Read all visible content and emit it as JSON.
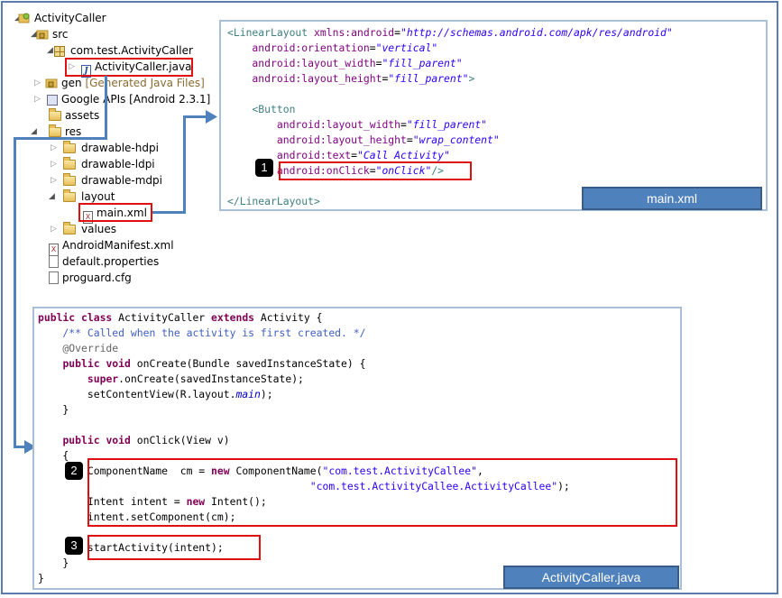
{
  "tree": {
    "items": [
      {
        "label": "ActivityCaller"
      },
      {
        "label": "src"
      },
      {
        "label": "com.test.ActivityCaller"
      },
      {
        "label": "ActivityCaller.java"
      },
      {
        "label": "gen",
        "suffix": "[Generated Java Files]"
      },
      {
        "label": "Google APIs [Android 2.3.1]"
      },
      {
        "label": "assets"
      },
      {
        "label": "res"
      },
      {
        "label": "drawable-hdpi"
      },
      {
        "label": "drawable-ldpi"
      },
      {
        "label": "drawable-mdpi"
      },
      {
        "label": "layout"
      },
      {
        "label": "main.xml"
      },
      {
        "label": "values"
      },
      {
        "label": "AndroidManifest.xml"
      },
      {
        "label": "default.properties"
      },
      {
        "label": "proguard.cfg"
      }
    ]
  },
  "xml_panel": {
    "label": "main.xml",
    "lines": [
      [
        {
          "t": "<LinearLayout ",
          "c": "tag"
        },
        {
          "t": "xmlns:android",
          "c": "attr"
        },
        {
          "t": "=",
          "c": "pl"
        },
        {
          "t": "\"http://schemas.android.com/apk/res/android\"",
          "c": "val"
        }
      ],
      [
        {
          "t": "    android:orientation",
          "c": "attr"
        },
        {
          "t": "=",
          "c": "pl"
        },
        {
          "t": "\"vertical\"",
          "c": "val"
        }
      ],
      [
        {
          "t": "    android:layout_width",
          "c": "attr"
        },
        {
          "t": "=",
          "c": "pl"
        },
        {
          "t": "\"fill_parent\"",
          "c": "val"
        }
      ],
      [
        {
          "t": "    android:layout_height",
          "c": "attr"
        },
        {
          "t": "=",
          "c": "pl"
        },
        {
          "t": "\"fill_parent\"",
          "c": "val"
        },
        {
          "t": ">",
          "c": "tag"
        }
      ],
      [],
      [
        {
          "t": "    <Button",
          "c": "tag"
        }
      ],
      [
        {
          "t": "        android:layout_width",
          "c": "attr"
        },
        {
          "t": "=",
          "c": "pl"
        },
        {
          "t": "\"fill_parent\"",
          "c": "val"
        }
      ],
      [
        {
          "t": "        android:layout_height",
          "c": "attr"
        },
        {
          "t": "=",
          "c": "pl"
        },
        {
          "t": "\"wrap_content\"",
          "c": "val"
        }
      ],
      [
        {
          "t": "        android:text",
          "c": "attr"
        },
        {
          "t": "=",
          "c": "pl"
        },
        {
          "t": "\"Call Activity\"",
          "c": "val"
        }
      ],
      [
        {
          "t": "        android:onClick",
          "c": "attr"
        },
        {
          "t": "=",
          "c": "pl"
        },
        {
          "t": "\"onClick\"",
          "c": "val"
        },
        {
          "t": "/>",
          "c": "tag"
        }
      ],
      [],
      [
        {
          "t": "</LinearLayout>",
          "c": "tag"
        }
      ]
    ]
  },
  "java_panel": {
    "label": "ActivityCaller.java",
    "lines": [
      [
        {
          "t": "public class ",
          "c": "kw"
        },
        {
          "t": "ActivityCaller ",
          "c": "pl"
        },
        {
          "t": "extends ",
          "c": "kw"
        },
        {
          "t": "Activity {",
          "c": "pl"
        }
      ],
      [
        {
          "t": "    /** Called when the activity is first created. */",
          "c": "cm"
        }
      ],
      [
        {
          "t": "    @Override",
          "c": "ann"
        }
      ],
      [
        {
          "t": "    ",
          "c": "pl"
        },
        {
          "t": "public void ",
          "c": "kw"
        },
        {
          "t": "onCreate(Bundle savedInstanceState) {",
          "c": "pl"
        }
      ],
      [
        {
          "t": "        ",
          "c": "pl"
        },
        {
          "t": "super",
          "c": "kw"
        },
        {
          "t": ".onCreate(savedInstanceState);",
          "c": "pl"
        }
      ],
      [
        {
          "t": "        setContentView(R.layout.",
          "c": "pl"
        },
        {
          "t": "main",
          "c": "it"
        },
        {
          "t": ");",
          "c": "pl"
        }
      ],
      [
        {
          "t": "    }",
          "c": "pl"
        }
      ],
      [],
      [
        {
          "t": "    ",
          "c": "pl"
        },
        {
          "t": "public void ",
          "c": "kw"
        },
        {
          "t": "onClick(View v)",
          "c": "pl"
        }
      ],
      [
        {
          "t": "    {",
          "c": "pl"
        }
      ],
      [
        {
          "t": "        ComponentName  cm = ",
          "c": "pl"
        },
        {
          "t": "new ",
          "c": "kw"
        },
        {
          "t": "ComponentName(",
          "c": "pl"
        },
        {
          "t": "\"com.test.ActivityCallee\"",
          "c": "str"
        },
        {
          "t": ",",
          "c": "pl"
        }
      ],
      [
        {
          "t": "                                            ",
          "c": "pl"
        },
        {
          "t": "\"com.test.ActivityCallee.ActivityCallee\"",
          "c": "str"
        },
        {
          "t": ");",
          "c": "pl"
        }
      ],
      [
        {
          "t": "        Intent intent = ",
          "c": "pl"
        },
        {
          "t": "new ",
          "c": "kw"
        },
        {
          "t": "Intent();",
          "c": "pl"
        }
      ],
      [
        {
          "t": "        intent.setComponent(cm);",
          "c": "pl"
        }
      ],
      [],
      [
        {
          "t": "        startActivity(intent);",
          "c": "pl"
        }
      ],
      [
        {
          "t": "    }",
          "c": "pl"
        }
      ],
      [
        {
          "t": "}",
          "c": "pl"
        }
      ]
    ]
  },
  "callouts": {
    "one": "1",
    "two": "2",
    "three": "3"
  },
  "colors": {
    "accent": "#4f81bd",
    "highlight": "#e01010"
  }
}
